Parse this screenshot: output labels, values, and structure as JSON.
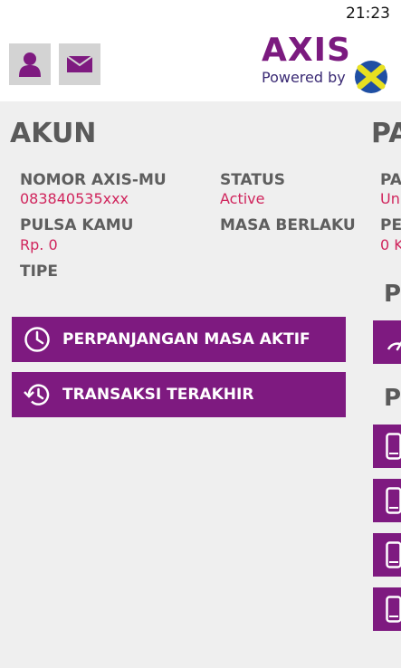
{
  "status_bar": {
    "time": "21:23"
  },
  "header": {
    "user_icon": "user-icon",
    "mail_icon": "mail-icon",
    "logo": {
      "brand": "AXIS",
      "tagline": "Powered by",
      "mark": "XL"
    }
  },
  "account": {
    "title": "AKUN",
    "number_label": "NOMOR AXIS-MU",
    "number_value": "083840535xxx",
    "status_label": "STATUS",
    "status_value": "Active",
    "balance_label": "PULSA KAMU",
    "balance_value": "Rp. 0",
    "validity_label": "MASA BERLAKU",
    "type_label": "TIPE",
    "buttons": [
      {
        "label": "PERPANJANGAN MASA AKTIF",
        "icon": "clock-icon"
      },
      {
        "label": "TRANSAKSI TERAKHIR",
        "icon": "history-icon"
      }
    ]
  },
  "right_panel": {
    "title": "PA",
    "label1": "PA",
    "value1": "Un",
    "label2": "PE",
    "value2": "0 K",
    "section2_title": "P",
    "section3_title": "P",
    "icons": [
      "speedometer-icon",
      "phone-icon",
      "phone-icon",
      "phone-icon",
      "phone-icon"
    ]
  },
  "colors": {
    "accent": "#7e1a80",
    "value_text": "#d0245c",
    "label_text": "#5e5e5e"
  }
}
